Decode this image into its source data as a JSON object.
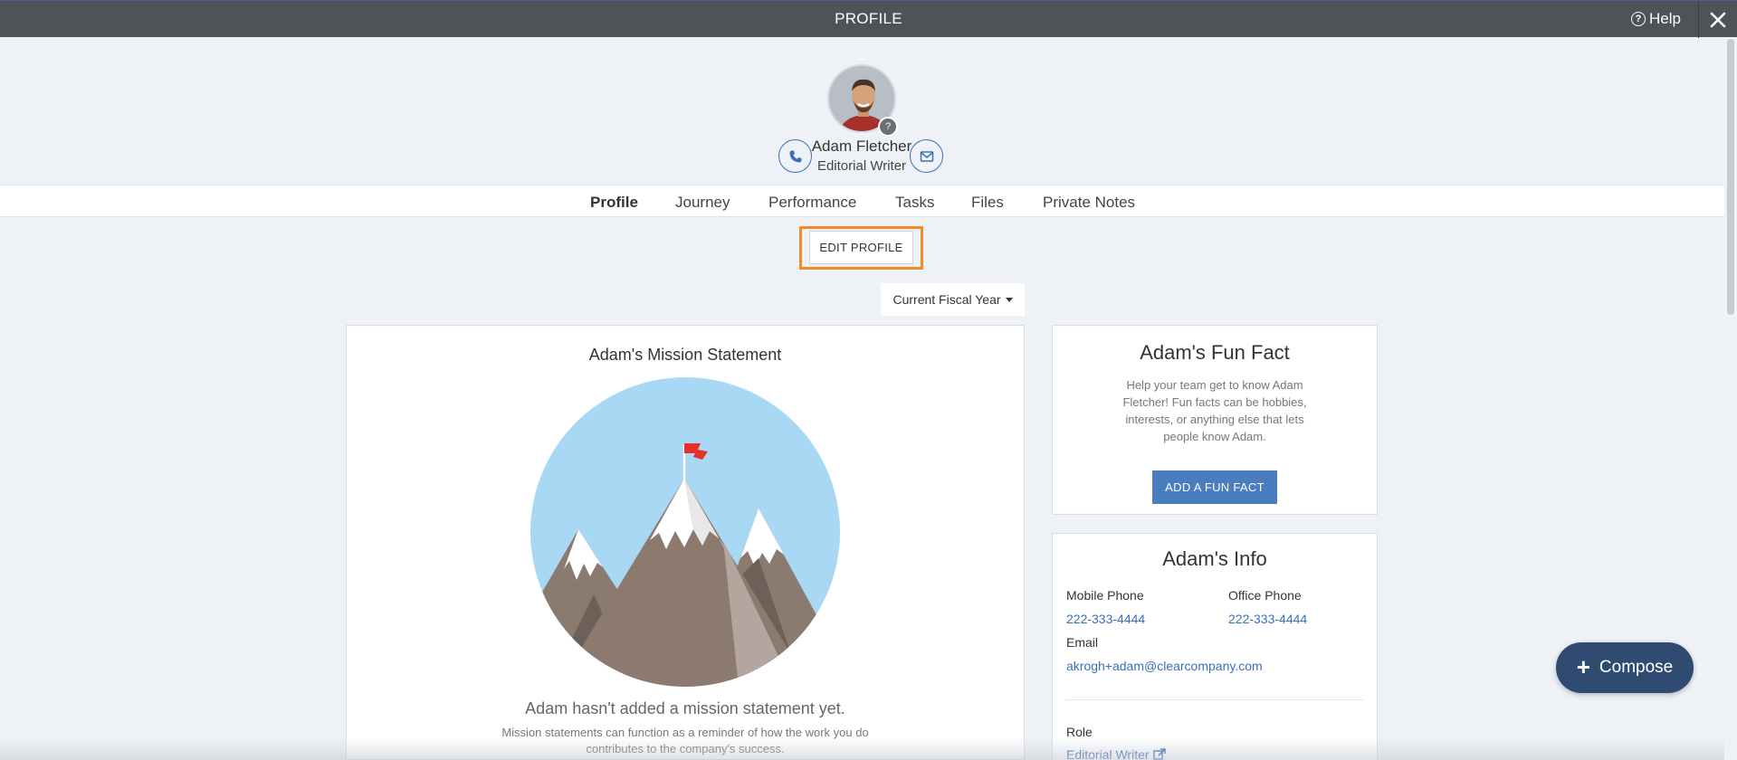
{
  "header": {
    "title": "PROFILE",
    "help_label": "Help",
    "help_icon": "question-circle-icon",
    "close_icon": "close-x-icon"
  },
  "person": {
    "name": "Adam Fletcher",
    "title": "Editorial Writer",
    "avatar_badge": "?"
  },
  "tabs": [
    {
      "label": "Profile",
      "active": true
    },
    {
      "label": "Journey",
      "active": false
    },
    {
      "label": "Performance",
      "active": false
    },
    {
      "label": "Tasks",
      "active": false
    },
    {
      "label": "Files",
      "active": false
    },
    {
      "label": "Private Notes",
      "active": false
    }
  ],
  "actions": {
    "edit_profile": "EDIT PROFILE",
    "fiscal_year": "Current Fiscal Year"
  },
  "mission": {
    "title": "Adam's Mission Statement",
    "empty": "Adam hasn't added a mission statement yet.",
    "desc": "Mission statements can function as a reminder of how the work you do contributes to the company's success."
  },
  "fun_fact": {
    "title": "Adam's Fun Fact",
    "desc": "Help your team get to know Adam Fletcher! Fun facts can be hobbies, interests, or anything else that lets people know Adam.",
    "button": "ADD A FUN FACT"
  },
  "info": {
    "title": "Adam's Info",
    "mobile_label": "Mobile Phone",
    "mobile_value": "222-333-4444",
    "office_label": "Office Phone",
    "office_value": "222-333-4444",
    "email_label": "Email",
    "email_value": "akrogh+adam@clearcompany.com",
    "role_label": "Role",
    "role_value": "Editorial Writer"
  },
  "compose": {
    "label": "Compose"
  },
  "colors": {
    "header_bg": "#4f5257",
    "link": "#3b6fb8",
    "primary_button": "#4a7dc0",
    "compose_bg": "#2f4b72",
    "highlight": "#f28c28"
  }
}
